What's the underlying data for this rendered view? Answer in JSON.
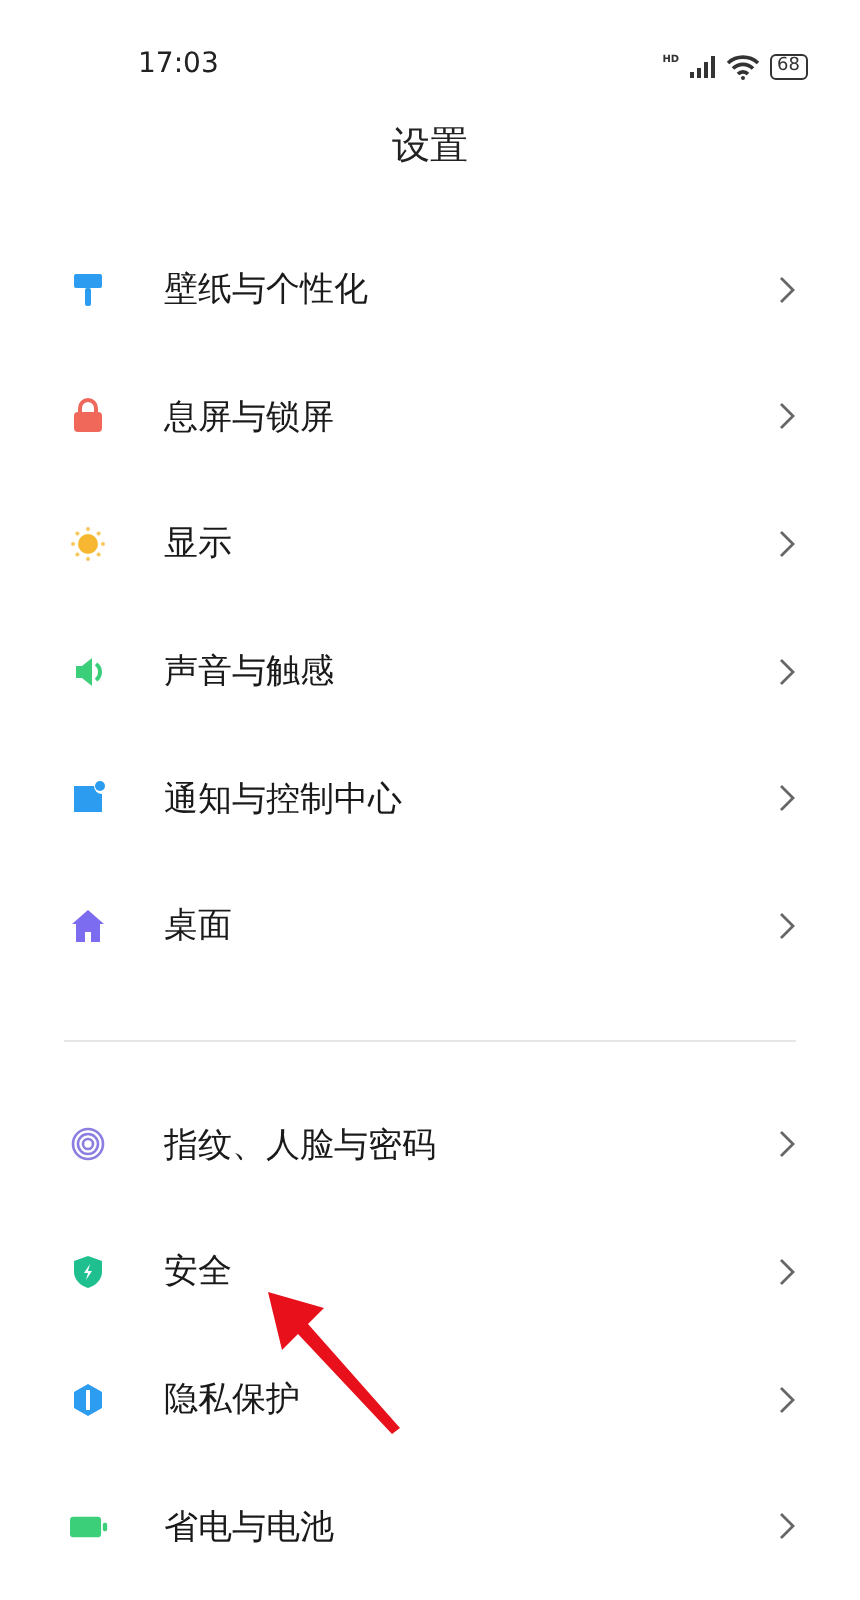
{
  "status_bar": {
    "time": "17:03",
    "network_label": "HD",
    "battery": "68"
  },
  "title": "设置",
  "sections": [
    {
      "items": [
        {
          "label": "壁纸与个性化",
          "kind": "wallpaper"
        },
        {
          "label": "息屏与锁屏",
          "kind": "lock"
        },
        {
          "label": "显示",
          "kind": "sun"
        },
        {
          "label": "声音与触感",
          "kind": "sound"
        },
        {
          "label": "通知与控制中心",
          "kind": "notification"
        },
        {
          "label": "桌面",
          "kind": "home"
        }
      ]
    },
    {
      "items": [
        {
          "label": "指纹、人脸与密码",
          "kind": "fingerprint"
        },
        {
          "label": "安全",
          "kind": "shield"
        },
        {
          "label": "隐私保护",
          "kind": "privacy"
        },
        {
          "label": "省电与电池",
          "kind": "battery"
        }
      ]
    }
  ]
}
